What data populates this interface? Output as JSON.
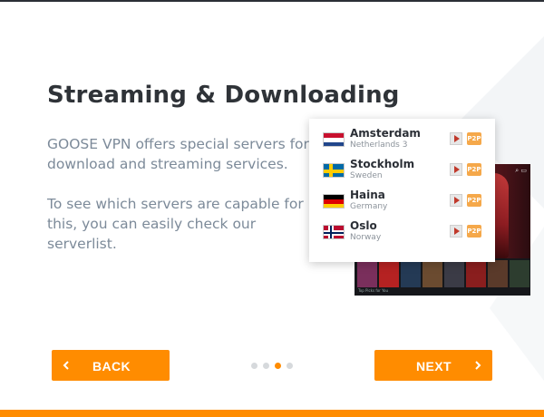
{
  "page": {
    "title": "Streaming & Downloading",
    "paragraph1": "GOOSE VPN offers special servers for download and streaming services.",
    "paragraph2": "To see which servers are capable for this, you can easily check our serverlist."
  },
  "servers": [
    {
      "city": "Amsterdam",
      "country": "Netherlands 3",
      "flag": "netherlands-flag-icon"
    },
    {
      "city": "Stockholm",
      "country": "Sweden",
      "flag": "sweden-flag-icon"
    },
    {
      "city": "Haina",
      "country": "Germany",
      "flag": "germany-flag-icon"
    },
    {
      "city": "Oslo",
      "country": "Norway",
      "flag": "norway-flag-icon"
    }
  ],
  "server_badges": {
    "play_icon": "play-icon",
    "p2p_label": "P2P"
  },
  "navigation": {
    "back_label": "BACK",
    "next_label": "NEXT",
    "pages_total": 4,
    "current_page": 3
  },
  "streaming_preview": {
    "row_caption": "Top Picks for You"
  },
  "colors": {
    "accent": "#ff8c00",
    "title": "#2f3338",
    "text": "#7c8a99",
    "p2p_badge": "#f5a84a"
  }
}
